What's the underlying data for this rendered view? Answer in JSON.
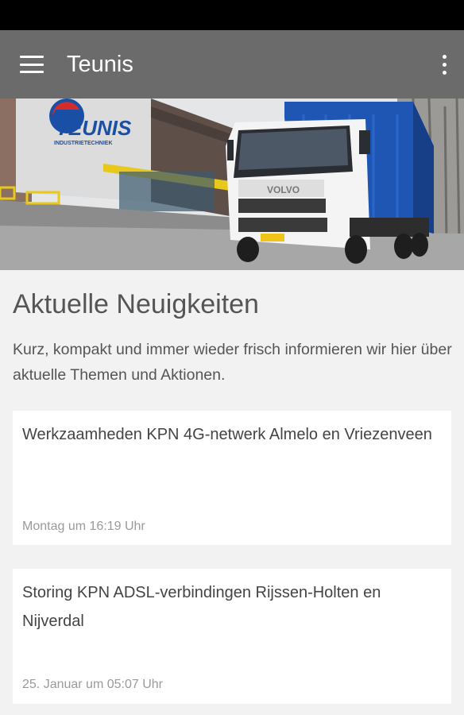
{
  "app_bar": {
    "title": "Teunis"
  },
  "hero": {
    "logo_text": "TEUNIS",
    "logo_subtext": "INDUSTRIETECHNIEK",
    "truck_brand": "VOLVO"
  },
  "news": {
    "heading": "Aktuelle Neuigkeiten",
    "intro": "Kurz, kompakt und immer wieder frisch informieren wir hier über aktuelle Themen und Aktionen.",
    "items": [
      {
        "title": "Werkzaamheden KPN 4G-netwerk Almelo en Vriezenveen",
        "date": "Montag um 16:19 Uhr"
      },
      {
        "title": "Storing KPN ADSL-verbindingen Rijssen-Holten en Nijverdal",
        "date": "25. Januar um 05:07 Uhr"
      }
    ]
  },
  "colors": {
    "app_bar": "#6b6b6b",
    "status_bar": "#000000",
    "background": "#f2f2f2",
    "container": "#1f56b3"
  }
}
